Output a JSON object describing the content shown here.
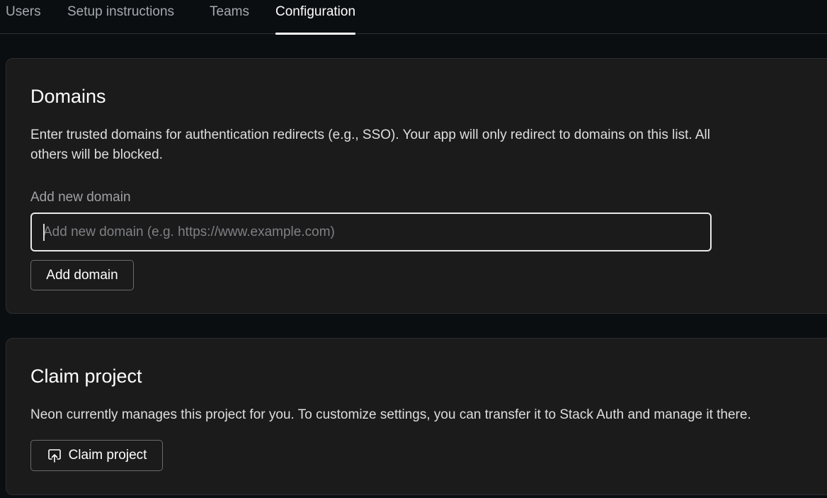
{
  "tabs": [
    {
      "label": "Users",
      "active": false
    },
    {
      "label": "Setup instructions",
      "active": false
    },
    {
      "label": "Teams",
      "active": false
    },
    {
      "label": "Configuration",
      "active": true
    }
  ],
  "domains": {
    "title": "Domains",
    "description": "Enter trusted domains for authentication redirects (e.g., SSO). Your app will only redirect to domains on this list. All others will be blocked.",
    "field_label": "Add new domain",
    "input_value": "",
    "input_placeholder": "Add new domain (e.g. https://www.example.com)",
    "add_button_label": "Add domain"
  },
  "claim": {
    "title": "Claim project",
    "description": "Neon currently manages this project for you. To customize settings, you can transfer it to Stack Auth and manage it there.",
    "button_label": "Claim project",
    "button_icon": "upload-box-icon"
  }
}
